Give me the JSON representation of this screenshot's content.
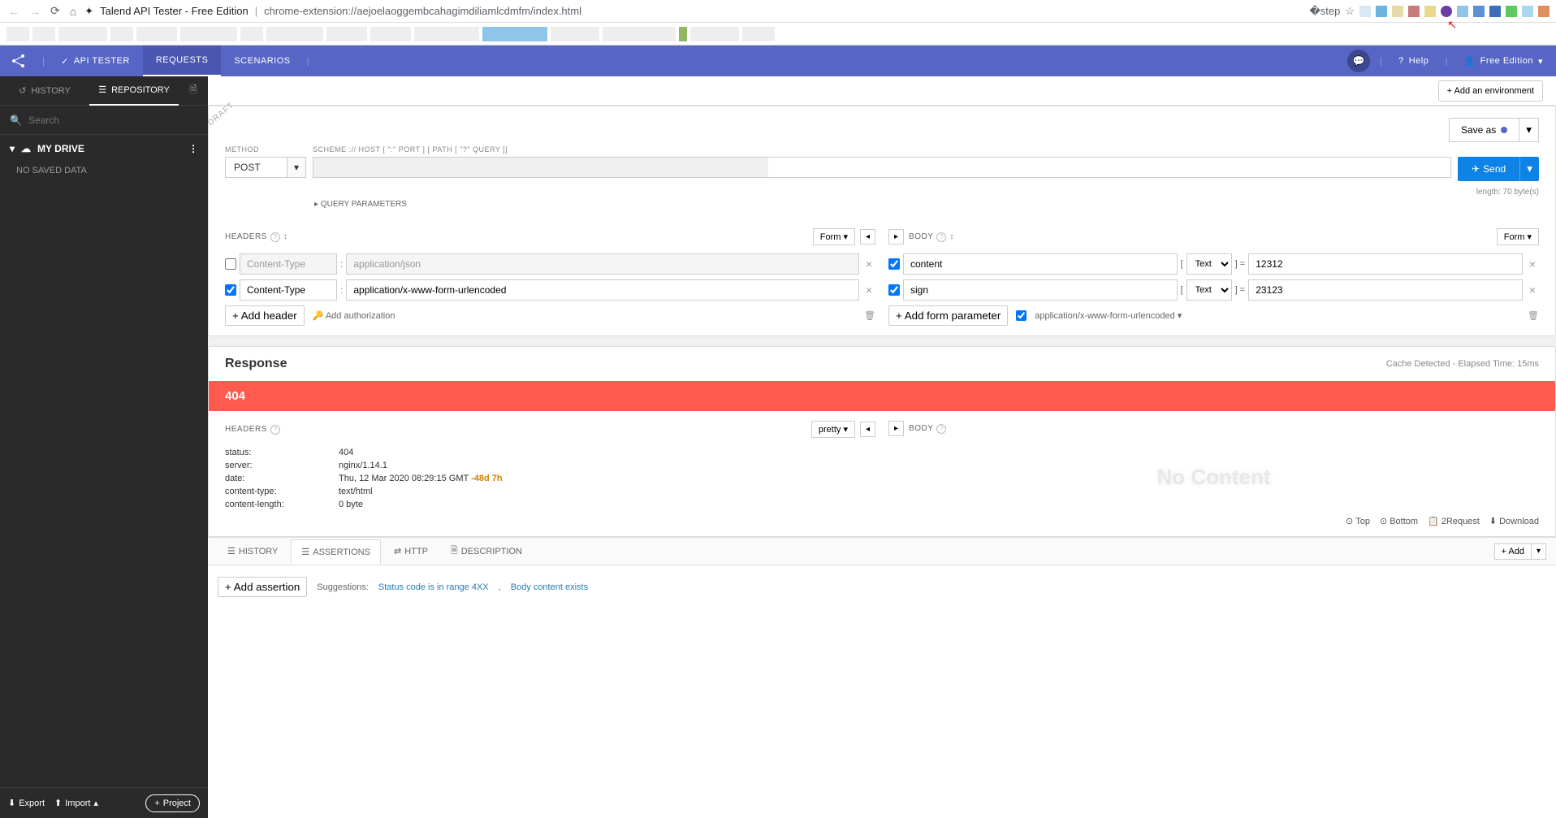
{
  "browser": {
    "title": "Talend API Tester - Free Edition",
    "url": "chrome-extension://aejoelaoggembcahagimdiliamlcdmfm/index.html"
  },
  "topnav": {
    "api_tester": "API TESTER",
    "requests": "REQUESTS",
    "scenarios": "SCENARIOS",
    "help": "Help",
    "edition": "Free Edition"
  },
  "sidebar": {
    "history_tab": "HISTORY",
    "repo_tab": "REPOSITORY",
    "search_placeholder": "Search",
    "my_drive": "MY DRIVE",
    "no_saved": "NO SAVED DATA",
    "export": "Export",
    "import": "Import",
    "project": "Project"
  },
  "env": {
    "add": "Add an environment"
  },
  "request": {
    "draft": "DRAFT",
    "save_as": "Save as",
    "method_label": "METHOD",
    "method": "POST",
    "url_label": "SCHEME :// HOST [ \":\" PORT ] [ PATH [ \"?\" QUERY ]]",
    "send": "Send",
    "length": "length: 70 byte(s)",
    "query_params": "QUERY PARAMETERS",
    "headers_title": "HEADERS",
    "body_title": "BODY",
    "form_toggle": "Form",
    "headers": [
      {
        "enabled": false,
        "name": "Content-Type",
        "value": "application/json"
      },
      {
        "enabled": true,
        "name": "Content-Type",
        "value": "application/x-www-form-urlencoded"
      }
    ],
    "add_header": "Add header",
    "add_auth": "Add authorization",
    "body_params": [
      {
        "enabled": true,
        "name": "content",
        "type": "Text",
        "value": "12312"
      },
      {
        "enabled": true,
        "name": "sign",
        "type": "Text",
        "value": "23123"
      }
    ],
    "add_form_param": "Add form parameter",
    "body_type": "application/x-www-form-urlencoded"
  },
  "response": {
    "title": "Response",
    "meta": "Cache Detected - Elapsed Time: 15ms",
    "status": "404",
    "headers_title": "HEADERS",
    "body_title": "BODY",
    "pretty": "pretty",
    "headers": {
      "status": {
        "k": "status:",
        "v": "404"
      },
      "server": {
        "k": "server:",
        "v": "nginx/1.14.1"
      },
      "date": {
        "k": "date:",
        "v_prefix": "Thu, 12 Mar 2020 08:29:15 GMT ",
        "v_hl": "-48d 7h"
      },
      "ctype": {
        "k": "content-type:",
        "v": "text/html"
      },
      "clen": {
        "k": "content-length:",
        "v": "0 byte"
      }
    },
    "no_content": "No Content",
    "actions": {
      "top": "Top",
      "bottom": "Bottom",
      "req": "2Request",
      "download": "Download"
    }
  },
  "tabs": {
    "history": "HISTORY",
    "assertions": "ASSERTIONS",
    "http": "HTTP",
    "description": "DESCRIPTION",
    "add": "Add"
  },
  "asserts": {
    "add": "Add assertion",
    "suggestions": "Suggestions:",
    "s1": "Status code is in range 4XX",
    "s2": "Body content exists"
  }
}
